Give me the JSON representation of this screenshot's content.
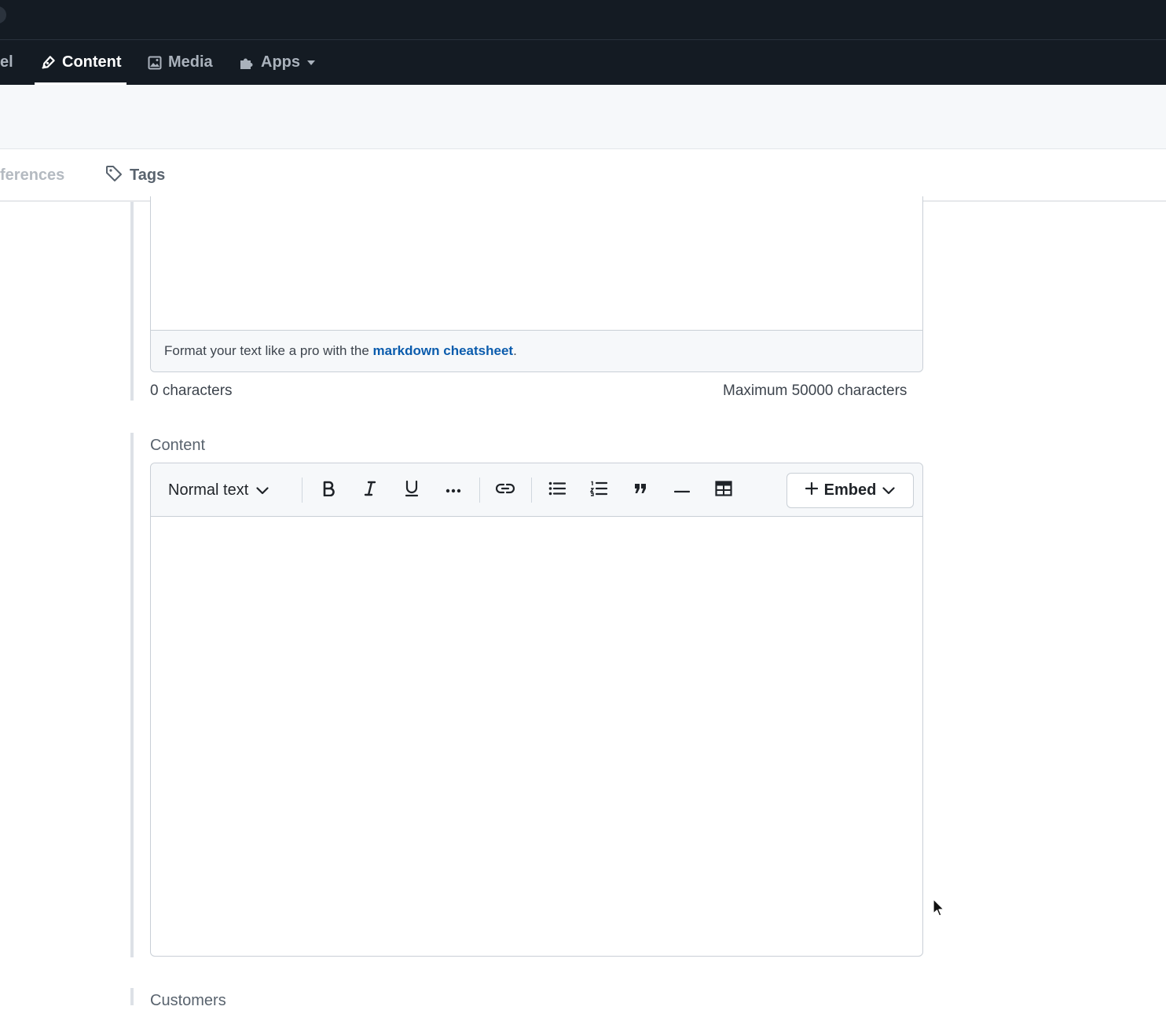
{
  "nav": {
    "partial_label": "el",
    "items": [
      {
        "label": "Content",
        "icon": "pen-icon",
        "active": true
      },
      {
        "label": "Media",
        "icon": "image-icon"
      },
      {
        "label": "Apps",
        "icon": "puzzle-icon",
        "has_dropdown": true
      }
    ]
  },
  "tabs": {
    "partial_label": "ferences",
    "tags_label": "Tags"
  },
  "markdown_field": {
    "help_prefix": "Format your text like a pro with the ",
    "help_link": "markdown cheatsheet",
    "help_suffix": ".",
    "char_count": "0 characters",
    "char_max": "Maximum 50000 characters"
  },
  "content_field": {
    "label": "Content",
    "style_select": "Normal text",
    "embed_label": "Embed"
  },
  "next_field": {
    "label": "Customers"
  }
}
